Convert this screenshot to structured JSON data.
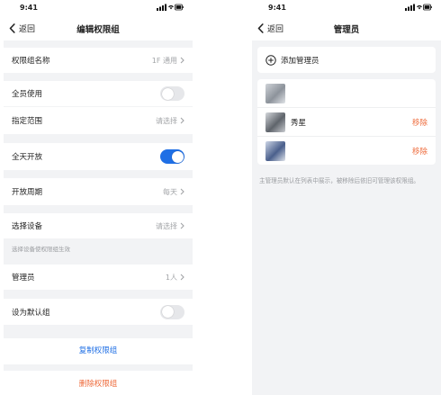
{
  "left": {
    "status_time": "9:41",
    "nav": {
      "back_label": "返回",
      "title": "编辑权限组"
    },
    "group_name": {
      "label": "权限组名称",
      "value": "1F 通用"
    },
    "all_users": {
      "label": "全员使用",
      "on": false
    },
    "scope": {
      "label": "指定范围",
      "value": "请选择"
    },
    "all_day": {
      "label": "全天开放",
      "on": true
    },
    "period": {
      "label": "开放周期",
      "value": "每天"
    },
    "device": {
      "label": "选择设备",
      "value": "请选择",
      "hint": "选择设备使权限组生效"
    },
    "admin": {
      "label": "管理员",
      "value": "1人"
    },
    "default_group": {
      "label": "设为默认组",
      "on": false
    },
    "copy_label": "复制权限组",
    "delete_label": "删除权限组"
  },
  "right": {
    "status_time": "9:41",
    "nav": {
      "back_label": "返回",
      "title": "管理员"
    },
    "add_label": "添加管理员",
    "members": [
      {
        "name": "",
        "remove": ""
      },
      {
        "name": "秀星",
        "remove": "移除"
      },
      {
        "name": "",
        "remove": "移除"
      }
    ],
    "note": "主管理员默认在列表中展示，被移除后依旧可管理该权限组。"
  },
  "colors": {
    "accent": "#1f6fe5",
    "danger": "#ee6a3a",
    "muted": "#a3a5a8",
    "background": "#f2f3f5"
  }
}
